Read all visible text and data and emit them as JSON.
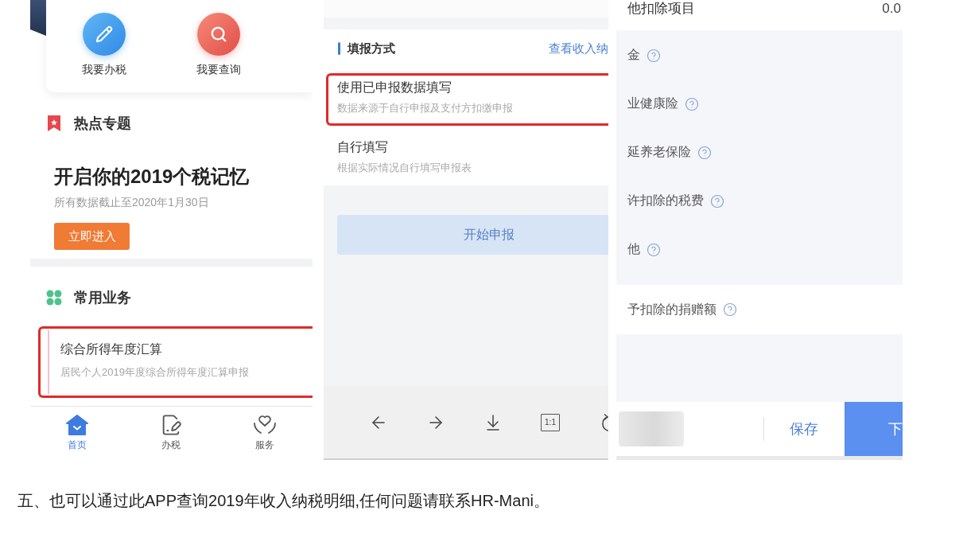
{
  "home_screen": {
    "quick_actions": [
      {
        "label": "我要办税"
      },
      {
        "label": "我要查询"
      }
    ],
    "hot_topics": {
      "heading": "热点专题",
      "title": "开启你的2019个税记忆",
      "subtitle": "所有数据截止至2020年1月30日",
      "button": "立即进入"
    },
    "common_services": {
      "heading": "常用业务",
      "items": [
        {
          "title": "综合所得年度汇算",
          "subtitle": "居民个人2019年度综合所得年度汇算申报",
          "highlighted": true
        }
      ]
    },
    "tab_bar": [
      {
        "label": "首页",
        "selected": true
      },
      {
        "label": "办税",
        "selected": false
      },
      {
        "label": "服务",
        "selected": false
      }
    ]
  },
  "filing_screen": {
    "heading": "填报方式",
    "link": "查看收入纳",
    "options": [
      {
        "title": "使用已申报数据填写",
        "subtitle": "数据来源于自行申报及支付方扣缴申报",
        "highlighted": true
      },
      {
        "title": "自行填写",
        "subtitle": "根据实际情况自行填写申报表",
        "highlighted": false
      }
    ],
    "submit_button": {
      "label": "开始申报",
      "disabled": true
    },
    "viewer_toolbar": {
      "actual_size": "1:1"
    }
  },
  "deductions_screen": {
    "section_title": "他扣除项目",
    "total": "0.0",
    "items": [
      {
        "label": "金"
      },
      {
        "label": "业健康险"
      },
      {
        "label": "延养老保险"
      },
      {
        "label": "许扣除的税费"
      },
      {
        "label": "他"
      }
    ],
    "donation": {
      "label": "予扣除的捐赠额"
    },
    "footer": {
      "save": "保存",
      "next": "下"
    }
  },
  "caption": "五、也可以通过此APP查询2019年收入纳税明细,任何问题请联系HR-Mani。"
}
